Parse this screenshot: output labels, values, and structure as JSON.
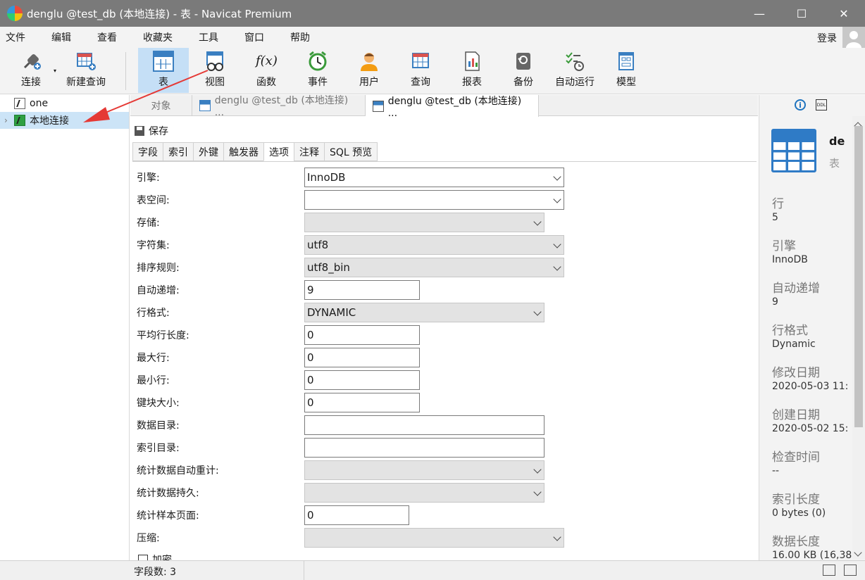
{
  "window": {
    "title": "denglu @test_db (本地连接) - 表 - Navicat Premium",
    "min": "—",
    "max": "☐",
    "close": "✕"
  },
  "menu": [
    "文件",
    "编辑",
    "查看",
    "收藏夹",
    "工具",
    "窗口",
    "帮助"
  ],
  "login_label": "登录",
  "toolbar": {
    "connect": "连接",
    "new_query": "新建查询",
    "items": [
      "表",
      "视图",
      "函数",
      "事件",
      "用户",
      "查询",
      "报表",
      "备份",
      "自动运行",
      "模型"
    ],
    "function_glyph": "f(x)"
  },
  "sidebar": {
    "items": [
      {
        "label": "one"
      },
      {
        "label": "本地连接"
      }
    ]
  },
  "tabs": [
    "对象",
    "denglu @test_db (本地连接) ...",
    "denglu @test_db (本地连接) ..."
  ],
  "save_label": "保存",
  "subtabs": [
    "字段",
    "索引",
    "外键",
    "触发器",
    "选项",
    "注释",
    "SQL 预览"
  ],
  "form": {
    "engine": {
      "label": "引擎:",
      "value": "InnoDB"
    },
    "tablespace": {
      "label": "表空间:",
      "value": ""
    },
    "storage": {
      "label": "存储:",
      "value": ""
    },
    "charset": {
      "label": "字符集:",
      "value": "utf8"
    },
    "collation": {
      "label": "排序规则:",
      "value": "utf8_bin"
    },
    "auto_increment": {
      "label": "自动递增:",
      "value": "9"
    },
    "row_format": {
      "label": "行格式:",
      "value": "DYNAMIC"
    },
    "avg_row_length": {
      "label": "平均行长度:",
      "value": "0"
    },
    "max_rows": {
      "label": "最大行:",
      "value": "0"
    },
    "min_rows": {
      "label": "最小行:",
      "value": "0"
    },
    "key_block_size": {
      "label": "键块大小:",
      "value": "0"
    },
    "data_directory": {
      "label": "数据目录:",
      "value": ""
    },
    "index_directory": {
      "label": "索引目录:",
      "value": ""
    },
    "stats_auto_recalc": {
      "label": "统计数据自动重计:",
      "value": ""
    },
    "stats_persistent": {
      "label": "统计数据持久:",
      "value": ""
    },
    "stats_sample_pages": {
      "label": "统计样本页面:",
      "value": "0"
    },
    "compression": {
      "label": "压缩:",
      "value": ""
    },
    "encryption": {
      "label": "加密"
    }
  },
  "info_panel": {
    "name": "de",
    "type": "表",
    "ddl_badge": "DDL",
    "info_glyph": "i",
    "props": [
      {
        "key": "行",
        "value": "5"
      },
      {
        "key": "引擎",
        "value": "InnoDB"
      },
      {
        "key": "自动递增",
        "value": "9"
      },
      {
        "key": "行格式",
        "value": "Dynamic"
      },
      {
        "key": "修改日期",
        "value": "2020-05-03 11:"
      },
      {
        "key": "创建日期",
        "value": "2020-05-02 15:"
      },
      {
        "key": "检查时间",
        "value": "--"
      },
      {
        "key": "索引长度",
        "value": "0 bytes (0)"
      },
      {
        "key": "数据长度",
        "value": "16.00 KB (16,38"
      }
    ]
  },
  "status": {
    "field_count": "字段数: 3"
  },
  "colors": {
    "accent": "#3a7fc1",
    "selected": "#cce4f7",
    "annotation": "#e53935"
  }
}
